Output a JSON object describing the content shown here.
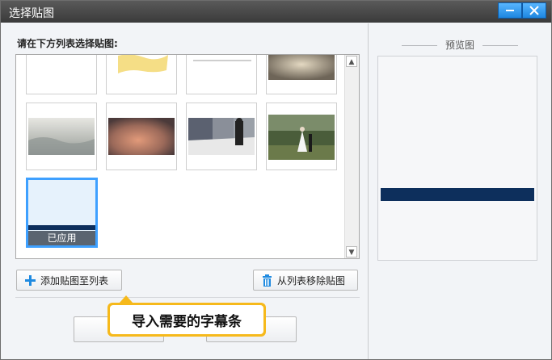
{
  "window": {
    "title": "选择贴图",
    "minimize_icon": "minimize-icon",
    "close_icon": "close-icon"
  },
  "left": {
    "hint": "请在下方列表选择贴图:",
    "thumbnails": [
      {
        "kind": "blank"
      },
      {
        "kind": "yellow-brush"
      },
      {
        "kind": "thin-line"
      },
      {
        "kind": "vintage-paper"
      },
      {
        "kind": "misty-sea"
      },
      {
        "kind": "orange-texture"
      },
      {
        "kind": "street-photo"
      },
      {
        "kind": "wedding-photo"
      },
      {
        "kind": "subtitle-bar",
        "applied_label": "已应用"
      }
    ],
    "add_button": "添加贴图至列表",
    "remove_button": "从列表移除贴图",
    "callout": "导入需要的字幕条"
  },
  "right": {
    "preview_label": "预览图",
    "strip_color": "#0d2f5c"
  },
  "colors": {
    "accent": "#3ea0ff",
    "callout": "#f6b91b",
    "titlebar": "#3f3f3f"
  }
}
